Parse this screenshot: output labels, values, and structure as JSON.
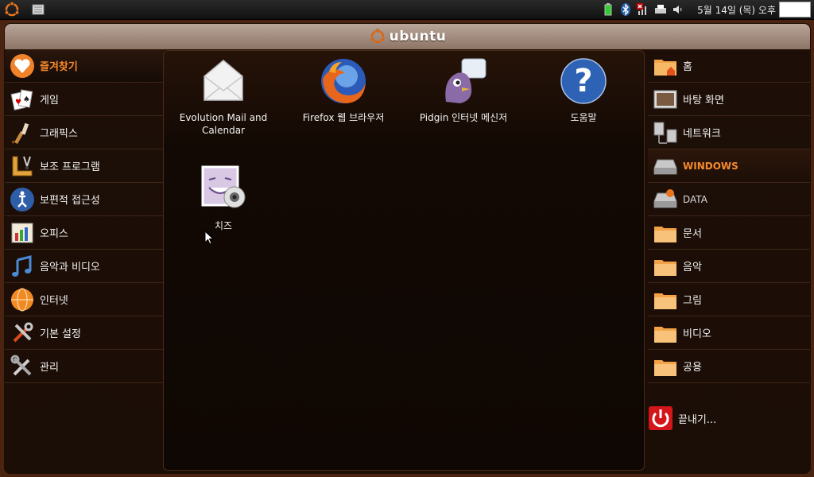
{
  "panel": {
    "clock": "5월 14일 (목) 오후",
    "icons": [
      "ubuntu-logo-icon",
      "document-icon",
      "battery-icon",
      "bluetooth-icon",
      "network-disconnected-icon",
      "printer-icon",
      "volume-icon"
    ]
  },
  "window": {
    "title": "ubuntu"
  },
  "categories": [
    {
      "label": "즐겨찾기",
      "icon": "heart-icon"
    },
    {
      "label": "게임",
      "icon": "cards-icon"
    },
    {
      "label": "그래픽스",
      "icon": "paint-icon"
    },
    {
      "label": "보조 프로그램",
      "icon": "ruler-scissors-icon"
    },
    {
      "label": "보편적 접근성",
      "icon": "accessibility-icon"
    },
    {
      "label": "오피스",
      "icon": "office-chart-icon"
    },
    {
      "label": "음악과 비디오",
      "icon": "music-note-icon"
    },
    {
      "label": "인터넷",
      "icon": "globe-icon"
    },
    {
      "label": "기본 설정",
      "icon": "preferences-tools-icon"
    },
    {
      "label": "관리",
      "icon": "admin-tools-icon"
    }
  ],
  "apps": [
    {
      "label": "Evolution Mail and Calendar",
      "icon": "mail-envelope-icon"
    },
    {
      "label": "Firefox 웹 브라우저",
      "icon": "firefox-icon"
    },
    {
      "label": "Pidgin 인터넷 메신저",
      "icon": "pidgin-icon"
    },
    {
      "label": "도움말",
      "icon": "help-icon"
    },
    {
      "label": "치즈",
      "icon": "cheese-webcam-icon"
    }
  ],
  "places": [
    {
      "label": "홈",
      "icon": "home-folder-icon"
    },
    {
      "label": "바탕 화면",
      "icon": "desktop-icon"
    },
    {
      "label": "네트워크",
      "icon": "network-icon"
    },
    {
      "label": "WINDOWS",
      "icon": "drive-icon"
    },
    {
      "label": "DATA",
      "icon": "drive-icon"
    },
    {
      "label": "문서",
      "icon": "folder-icon"
    },
    {
      "label": "음악",
      "icon": "folder-icon"
    },
    {
      "label": "그림",
      "icon": "folder-icon"
    },
    {
      "label": "비디오",
      "icon": "folder-icon"
    },
    {
      "label": "공용",
      "icon": "folder-icon"
    }
  ],
  "quit": {
    "label": "끝내기...",
    "icon": "power-icon"
  },
  "colors": {
    "accent": "#f78a2d",
    "background": "#1b0e07",
    "frame": "#4a2410"
  }
}
